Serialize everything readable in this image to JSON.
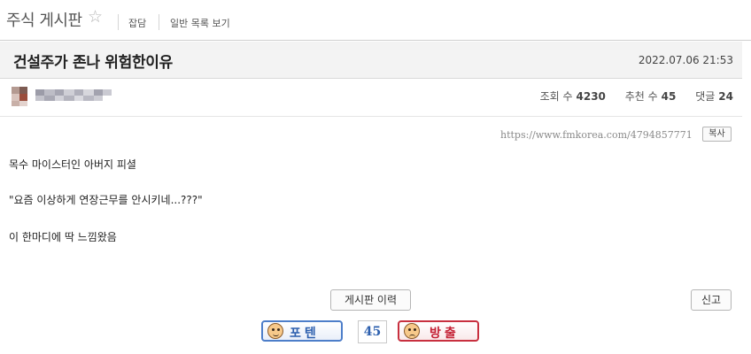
{
  "board": {
    "title": "주식 게시판",
    "star_icon": "star-outline-icon",
    "nav": {
      "chat": "잡담",
      "list_view": "일반 목록 보기"
    }
  },
  "post": {
    "title": "건설주가 존나 위험한이유",
    "date": "2022.07.06 21:53",
    "stats": {
      "views_label": "조회 수",
      "views": "4230",
      "recommend_label": "추천 수",
      "recommend": "45",
      "comments_label": "댓글",
      "comments": "24"
    },
    "url": "https://www.fmkorea.com/4794857771",
    "copy_label": "복사",
    "body": [
      "목수 마이스터인 아버지 피셜",
      "\"요즘 이상하게 연장근무를 안시키네...???\"",
      "이 한마디에 딱 느낌왔음"
    ]
  },
  "actions": {
    "history_label": "게시판 이력",
    "report_label": "신고",
    "vote_up_label": "포텐",
    "vote_count": "45",
    "vote_down_label": "방출"
  },
  "colors": {
    "accent_blue": "#2c5fae",
    "accent_red": "#c42034"
  }
}
